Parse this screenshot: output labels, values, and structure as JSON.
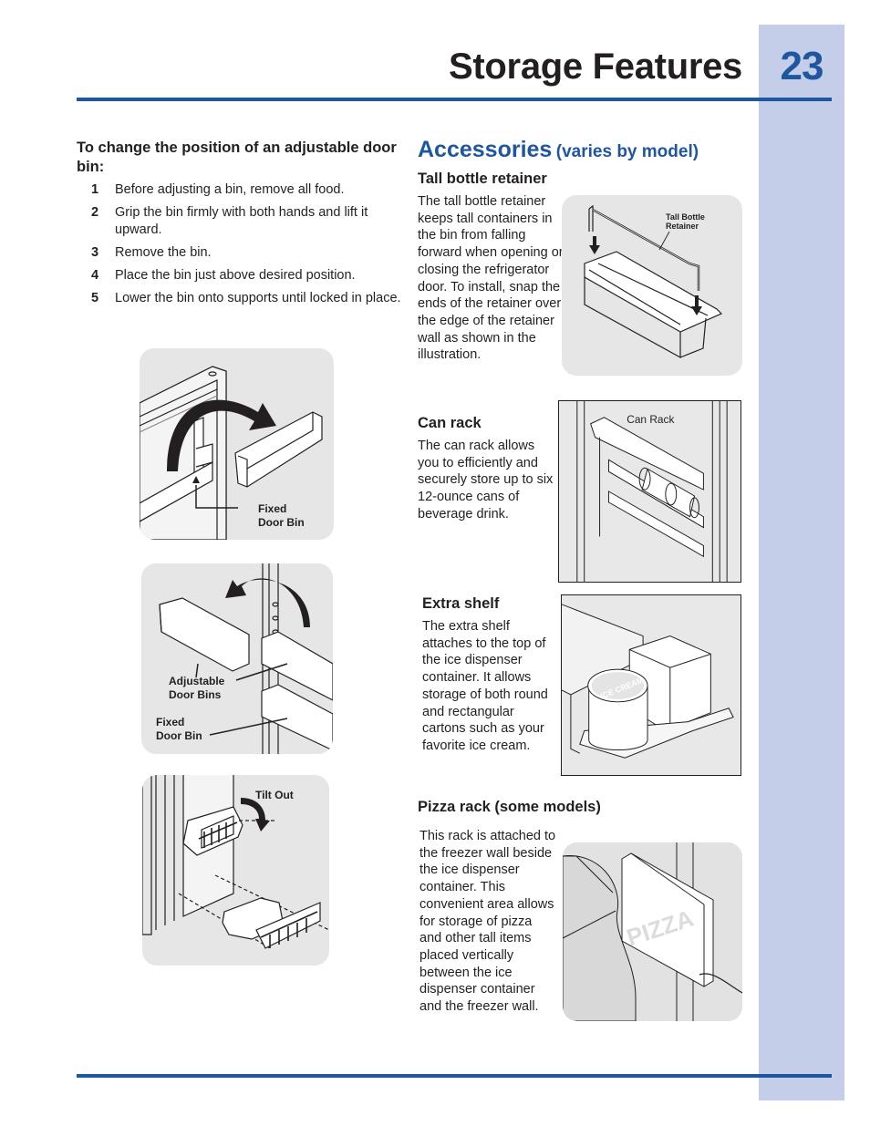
{
  "header": {
    "title": "Storage Features",
    "page_number": "23"
  },
  "colors": {
    "accent_blue": "#1f56a0",
    "sidebar": "#c5cee8",
    "text": "#231f20",
    "figure_background": "#e6e6e6"
  },
  "left_column": {
    "heading": "To change the position of an adjustable door bin:",
    "steps": [
      {
        "number": "1",
        "text": "Before adjusting a bin, remove all food."
      },
      {
        "number": "2",
        "text": "Grip the bin firmly with both hands and lift it upward."
      },
      {
        "number": "3",
        "text": "Remove the bin."
      },
      {
        "number": "4",
        "text": "Place the bin just above desired position."
      },
      {
        "number": "5",
        "text": "Lower the bin onto supports until locked in place."
      }
    ],
    "figures": [
      {
        "icon": "fixed-door-bin-removal-illustration",
        "labels": [
          "Fixed",
          "Door Bin"
        ]
      },
      {
        "icon": "adjustable-door-bins-illustration",
        "labels": [
          "Adjustable",
          "Door Bins",
          "Fixed",
          "Door Bin"
        ]
      },
      {
        "icon": "tilt-out-bin-illustration",
        "labels": [
          "Tilt Out"
        ]
      }
    ]
  },
  "accessories": {
    "heading": "Accessories",
    "heading_note": "(varies by model)",
    "sections": [
      {
        "title": "Tall bottle retainer",
        "text": "The tall bottle retainer keeps tall containers in the bin from falling forward when opening or closing the refrigerator door. To install, snap the ends of the retainer over the edge of the retainer wall as shown in the illustration.",
        "figure_label": [
          "Tall Bottle",
          "Retainer"
        ]
      },
      {
        "title": "Can rack",
        "text": "The can rack allows you to efficiently and securely store up to six 12-ounce cans of beverage drink.",
        "figure_label": [
          "Can Rack"
        ]
      },
      {
        "title": "Extra shelf",
        "text": "The extra shelf attaches to the top of the ice dispenser container. It allows storage of both round and rectangular cartons such as your favorite ice cream.",
        "figure_label": [
          "ICE CREAM",
          "ICE CREAM"
        ]
      },
      {
        "title": "Pizza rack (some models)",
        "text": "This rack is attached to the freezer wall beside the ice dispenser container. This convenient area allows for storage of pizza and other tall items placed vertically between the ice dispenser container and the freezer wall.",
        "figure_label": [
          "PIZZA"
        ]
      }
    ]
  }
}
